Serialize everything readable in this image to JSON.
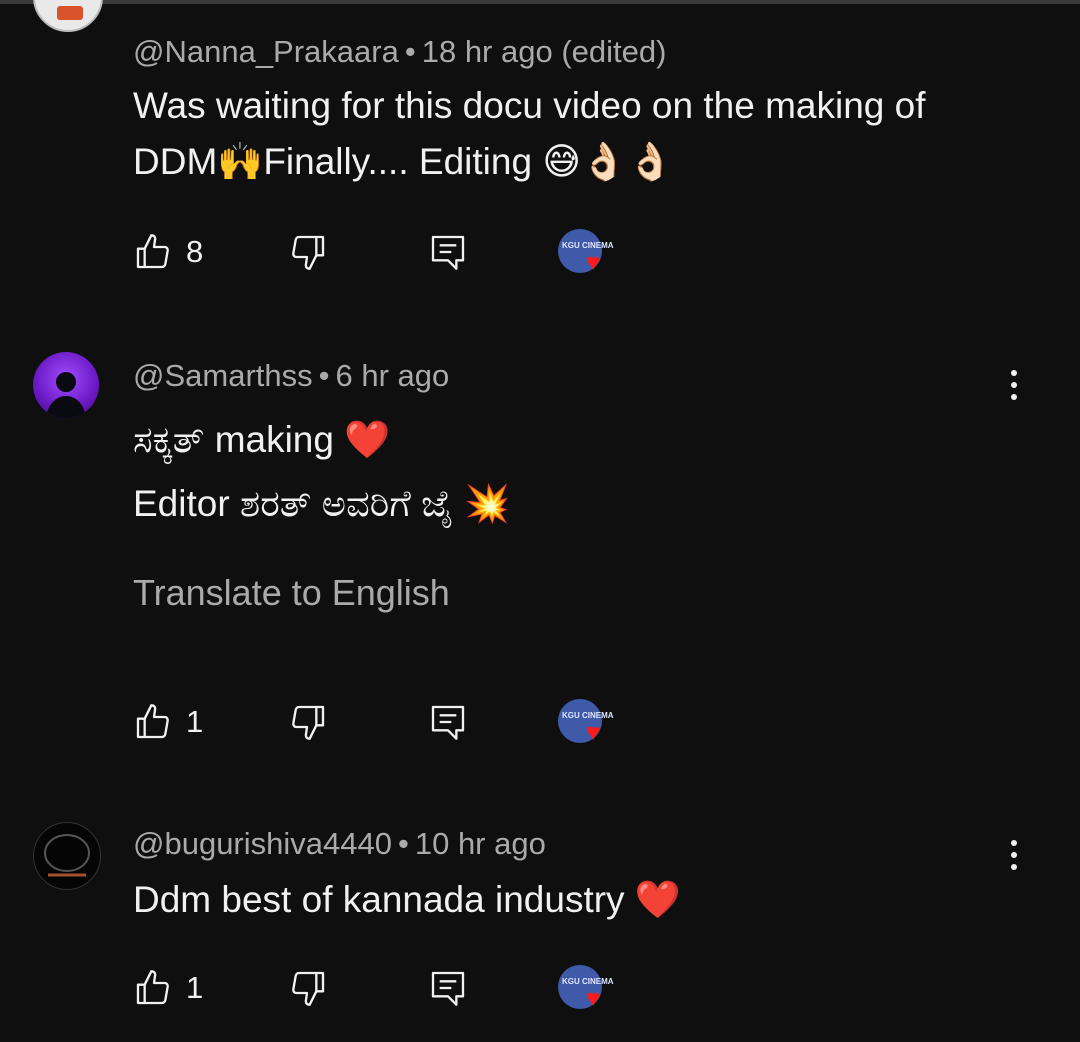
{
  "comments": [
    {
      "handle": "@Nanna_Prakaara",
      "time": "18 hr ago",
      "edited": "(edited)",
      "text_line1": "Was waiting for this docu video on the making of",
      "text_line2": "DDM🙌Finally.... Editing 😅👌🏻👌🏻",
      "likes": "8"
    },
    {
      "handle": "@Samarthss",
      "time": "6 hr ago",
      "text_line1": "ಸಕ್ಕತ್ making ❤️",
      "text_line2": "Editor ಶರತ್ ಅವರಿಗೆ ಜೈ 💥",
      "translate": "Translate to English",
      "likes": "1"
    },
    {
      "handle": "@bugurishiva4440",
      "time": "10 hr ago",
      "text_line1": "Ddm  best of kannada industry ❤️",
      "likes": "1"
    }
  ],
  "dot_separator": "•",
  "creator_avatar_text": "KGU CINEMA",
  "heart_glyph": "♥",
  "icons": [
    "thumbs-up-icon",
    "thumbs-down-icon",
    "reply-icon",
    "more-vertical-icon"
  ],
  "colors": {
    "background": "#0f0f0f",
    "text": "#f1f1f1",
    "secondary": "#aaaaaa",
    "heart": "#ff1a1a"
  }
}
